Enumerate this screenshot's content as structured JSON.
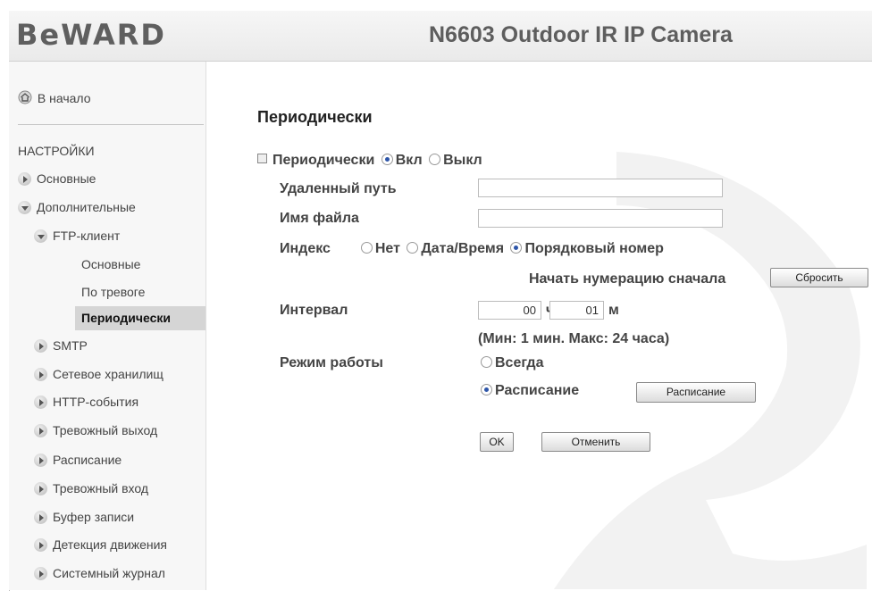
{
  "header": {
    "logo": "BeWARD",
    "camera_title": "N6603 Outdoor IR IP Camera"
  },
  "sidebar": {
    "home": "В начало",
    "section_title": "НАСТРОЙКИ",
    "items": [
      {
        "label": "Основные"
      },
      {
        "label": "Дополнительные"
      },
      {
        "label": "FTP-клиент"
      },
      {
        "label": "Основные"
      },
      {
        "label": "По тревоге"
      },
      {
        "label": "Периодически"
      },
      {
        "label": "SMTP"
      },
      {
        "label": "Сетевое хранилищ"
      },
      {
        "label": "HTTP-события"
      },
      {
        "label": "Тревожный выход"
      },
      {
        "label": "Расписание"
      },
      {
        "label": "Тревожный вход"
      },
      {
        "label": "Буфер записи"
      },
      {
        "label": "Детекция движения"
      },
      {
        "label": "Системный журнал"
      }
    ]
  },
  "main": {
    "title": "Периодически",
    "enable_label": "Периодически",
    "on_label": "Вкл",
    "off_label": "Выкл",
    "remote_path_label": "Удаленный путь",
    "remote_path_value": "",
    "filename_label": "Имя файла",
    "filename_value": "",
    "index_label": "Индекс",
    "index_none": "Нет",
    "index_datetime": "Дата/Время",
    "index_sequence": "Порядковый номер",
    "restart_numbering_label": "Начать нумерацию сначала",
    "reset_button": "Сбросить",
    "interval_label": "Интервал",
    "interval_hours": "00",
    "hours_unit": "ч",
    "interval_minutes": "01",
    "minutes_unit": "м",
    "interval_hint": "(Мин: 1 мин. Макс: 24 часа)",
    "mode_label": "Режим работы",
    "mode_always": "Всегда",
    "mode_schedule": "Расписание",
    "schedule_button": "Расписание",
    "ok_button": "OK",
    "cancel_button": "Отменить"
  },
  "colors": {
    "active_nav_bg": "#d5d5d5",
    "radio_selected": "#2d55a8"
  }
}
